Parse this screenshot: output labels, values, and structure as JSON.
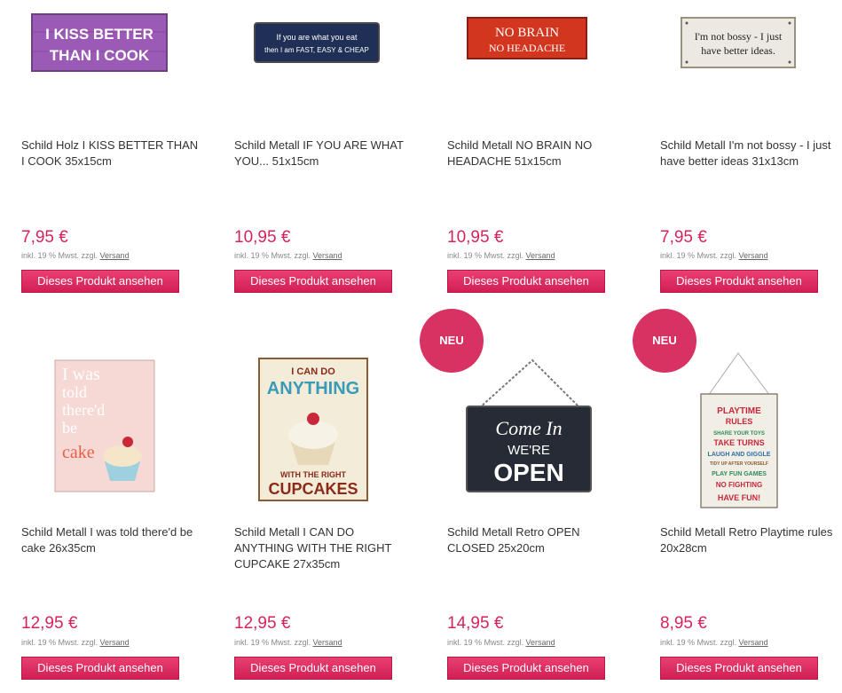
{
  "products": [
    {
      "title": "Schild Holz I KISS BETTER THAN I COOK 35x15cm",
      "price": "7,95 €",
      "vat": "inkl. 19 % Mwst. zzgl.",
      "shipping": "Versand",
      "button": "Dieses Produkt ansehen",
      "sign": [
        "I KISS BETTER",
        "THAN I COOK"
      ]
    },
    {
      "title": "Schild Metall IF YOU ARE WHAT YOU... 51x15cm",
      "price": "10,95 €",
      "vat": "inkl. 19 % Mwst. zzgl.",
      "shipping": "Versand",
      "button": "Dieses Produkt ansehen",
      "sign": [
        "If you are what you eat",
        "then I am FAST, EASY & CHEAP"
      ]
    },
    {
      "title": "Schild Metall NO BRAIN NO HEADACHE 51x15cm",
      "price": "10,95 €",
      "vat": "inkl. 19 % Mwst. zzgl.",
      "shipping": "Versand",
      "button": "Dieses Produkt ansehen",
      "sign": [
        "NO BRAIN",
        "NO HEADACHE"
      ]
    },
    {
      "title": "Schild Metall I'm not bossy - I just have better ideas 31x13cm",
      "price": "7,95 €",
      "vat": "inkl. 19 % Mwst. zzgl.",
      "shipping": "Versand",
      "button": "Dieses Produkt ansehen",
      "sign": [
        "I'm not bossy - I just",
        "have better ideas."
      ]
    },
    {
      "title": "Schild Metall I was told there'd be cake 26x35cm",
      "price": "12,95 €",
      "vat": "inkl. 19 % Mwst. zzgl.",
      "shipping": "Versand",
      "button": "Dieses Produkt ansehen",
      "sign": [
        "I was",
        "told",
        "there'd",
        "be",
        "cake"
      ]
    },
    {
      "title": "Schild Metall I CAN DO ANYTHING WITH THE RIGHT CUPCAKE 27x35cm",
      "price": "12,95 €",
      "vat": "inkl. 19 % Mwst. zzgl.",
      "shipping": "Versand",
      "button": "Dieses Produkt ansehen",
      "sign": [
        "I CAN DO",
        "ANYTHING",
        "WITH THE RIGHT",
        "CUPCAKES"
      ]
    },
    {
      "title": "Schild Metall Retro OPEN CLOSED 25x20cm",
      "price": "14,95 €",
      "vat": "inkl. 19 % Mwst. zzgl.",
      "shipping": "Versand",
      "button": "Dieses Produkt ansehen",
      "badge": "NEU",
      "sign": [
        "Come In",
        "WE'RE",
        "OPEN"
      ]
    },
    {
      "title": "Schild Metall Retro Playtime rules 20x28cm",
      "price": "8,95 €",
      "vat": "inkl. 19 % Mwst. zzgl.",
      "shipping": "Versand",
      "button": "Dieses Produkt ansehen",
      "badge": "NEU",
      "sign": [
        "PLAYTIME",
        "RULES",
        "SHARE YOUR TOYS",
        "TAKE TURNS",
        "LAUGH AND GIGGLE",
        "TIDY UP AFTER YOURSELF",
        "PLAY FUN GAMES",
        "NO FIGHTING",
        "HAVE FUN!"
      ]
    }
  ],
  "colors": {
    "price": "#d6245a",
    "button": "#e0306a",
    "badge": "#d83262"
  }
}
